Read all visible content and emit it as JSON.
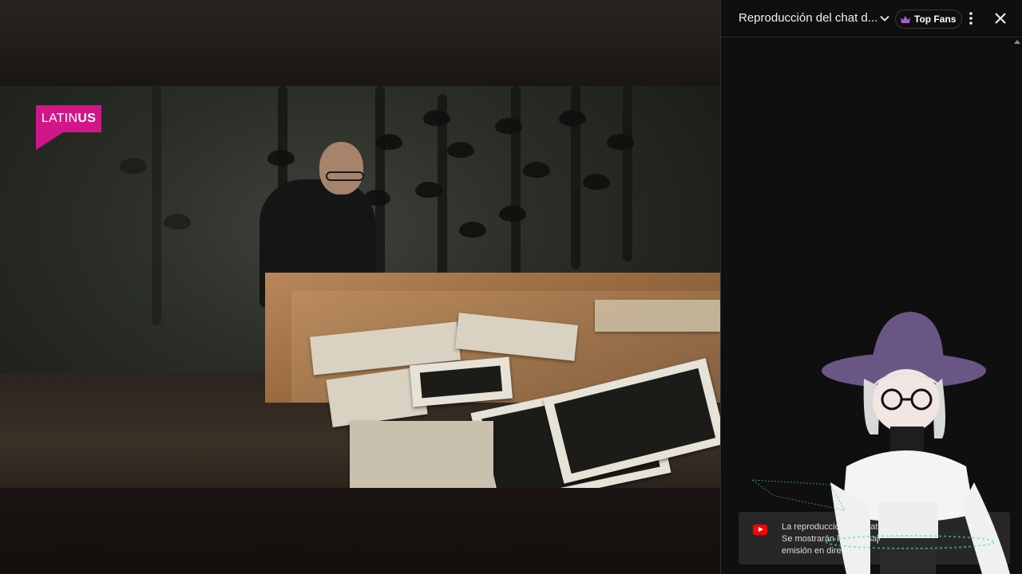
{
  "video": {
    "channel_logo": {
      "text_light": "LATIN",
      "text_bold": "US",
      "color": "#d2168a"
    }
  },
  "chat_panel": {
    "title": "Reproducción del chat d...",
    "badge_label": "Top Fans",
    "icons": [
      "chevron-down-icon",
      "crown-icon",
      "more-vert-icon",
      "close-icon"
    ],
    "notice": {
      "line1": "La reproducción del chat está activa.",
      "line2": "Se mostrarán los mensajes de la",
      "line3": "emisión en directo."
    }
  },
  "overlay": {
    "avatar": "vtuber-avatar-witch-hat"
  }
}
